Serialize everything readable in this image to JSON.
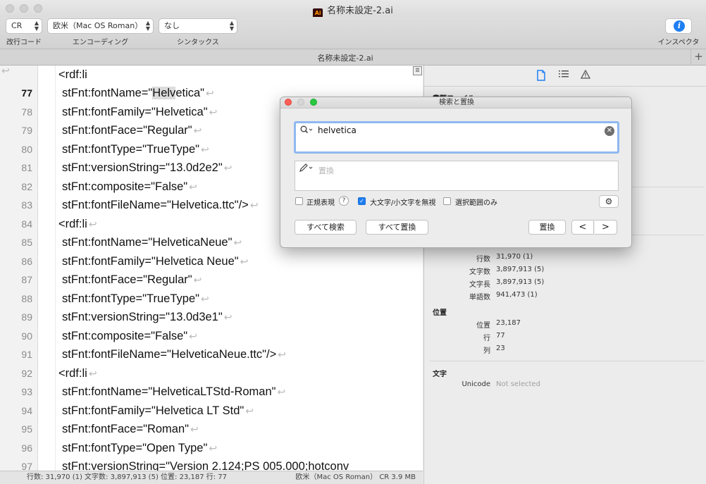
{
  "window": {
    "title": "名称未設定-2.ai",
    "app_badge": "Ai"
  },
  "toolbar": {
    "line_ending": {
      "value": "CR",
      "label": "改行コード"
    },
    "encoding": {
      "value": "欧米（Mac OS Roman）",
      "label": "エンコーディング"
    },
    "syntax": {
      "value": "なし",
      "label": "シンタックス"
    },
    "inspector": {
      "label": "インスペクタ",
      "glyph": "i"
    }
  },
  "tab": {
    "title": "名称未設定-2.ai",
    "plus": "+"
  },
  "editor": {
    "cr_mark": "↩",
    "partial_top": "<rdf:li",
    "lines": [
      {
        "n": "77",
        "pre": "stFnt:fontName=\"",
        "hl": "Helv",
        "post": "etica\""
      },
      {
        "n": "78",
        "text": "stFnt:fontFamily=\"Helvetica\""
      },
      {
        "n": "79",
        "text": "stFnt:fontFace=\"Regular\""
      },
      {
        "n": "80",
        "text": "stFnt:fontType=\"TrueType\""
      },
      {
        "n": "81",
        "text": "stFnt:versionString=\"13.0d2e2\""
      },
      {
        "n": "82",
        "text": "stFnt:composite=\"False\""
      },
      {
        "n": "83",
        "text": "stFnt:fontFileName=\"Helvetica.ttc\"/>"
      },
      {
        "n": "84",
        "text": "<rdf:li"
      },
      {
        "n": "85",
        "text": "stFnt:fontName=\"HelveticaNeue\""
      },
      {
        "n": "86",
        "text": "stFnt:fontFamily=\"Helvetica Neue\""
      },
      {
        "n": "87",
        "text": "stFnt:fontFace=\"Regular\""
      },
      {
        "n": "88",
        "text": "stFnt:fontType=\"TrueType\""
      },
      {
        "n": "89",
        "text": "stFnt:versionString=\"13.0d3e1\""
      },
      {
        "n": "90",
        "text": "stFnt:composite=\"False\""
      },
      {
        "n": "91",
        "text": "stFnt:fontFileName=\"HelveticaNeue.ttc\"/>"
      },
      {
        "n": "92",
        "text": "<rdf:li"
      },
      {
        "n": "93",
        "text": "stFnt:fontName=\"HelveticaLTStd-Roman\""
      },
      {
        "n": "94",
        "text": "stFnt:fontFamily=\"Helvetica LT Std\""
      },
      {
        "n": "95",
        "text": "stFnt:fontFace=\"Roman\""
      },
      {
        "n": "96",
        "text": "stFnt:fontType=\"Open Type\""
      },
      {
        "n": "97",
        "text": "stFnt:versionString=\"Version 2.124;PS 005.000;hotconv"
      }
    ]
  },
  "statusbar": {
    "left": "行数: 31,970 (1)   文字数: 3,897,913 (5)   位置: 23,187   行: 77",
    "right": "欧米（Mac OS Roman）    CR    3.9 MB"
  },
  "inspector": {
    "partial_head": "書類ファイル",
    "counts": [
      {
        "key": "行数",
        "value": "31,970 (1)"
      },
      {
        "key": "文字数",
        "value": "3,897,913 (5)"
      },
      {
        "key": "文字長",
        "value": "3,897,913 (5)"
      },
      {
        "key": "単語数",
        "value": "941,473 (1)"
      }
    ],
    "position": {
      "title": "位置",
      "rows": [
        {
          "key": "位置",
          "value": "23,187"
        },
        {
          "key": "行",
          "value": "77"
        },
        {
          "key": "列",
          "value": "23"
        }
      ]
    },
    "character": {
      "title": "文字",
      "key": "Unicode",
      "value": "Not selected"
    }
  },
  "find_dialog": {
    "title": "検索と置換",
    "search_value": "helvetica",
    "replace_placeholder": "置換",
    "options": {
      "regex": "正規表現",
      "help": "?",
      "ignore_case": "大文字/小文字を無視",
      "in_selection": "選択範囲のみ"
    },
    "buttons": {
      "find_all": "すべて検索",
      "replace_all": "すべて置換",
      "replace": "置換",
      "prev": "<",
      "next": ">"
    }
  }
}
